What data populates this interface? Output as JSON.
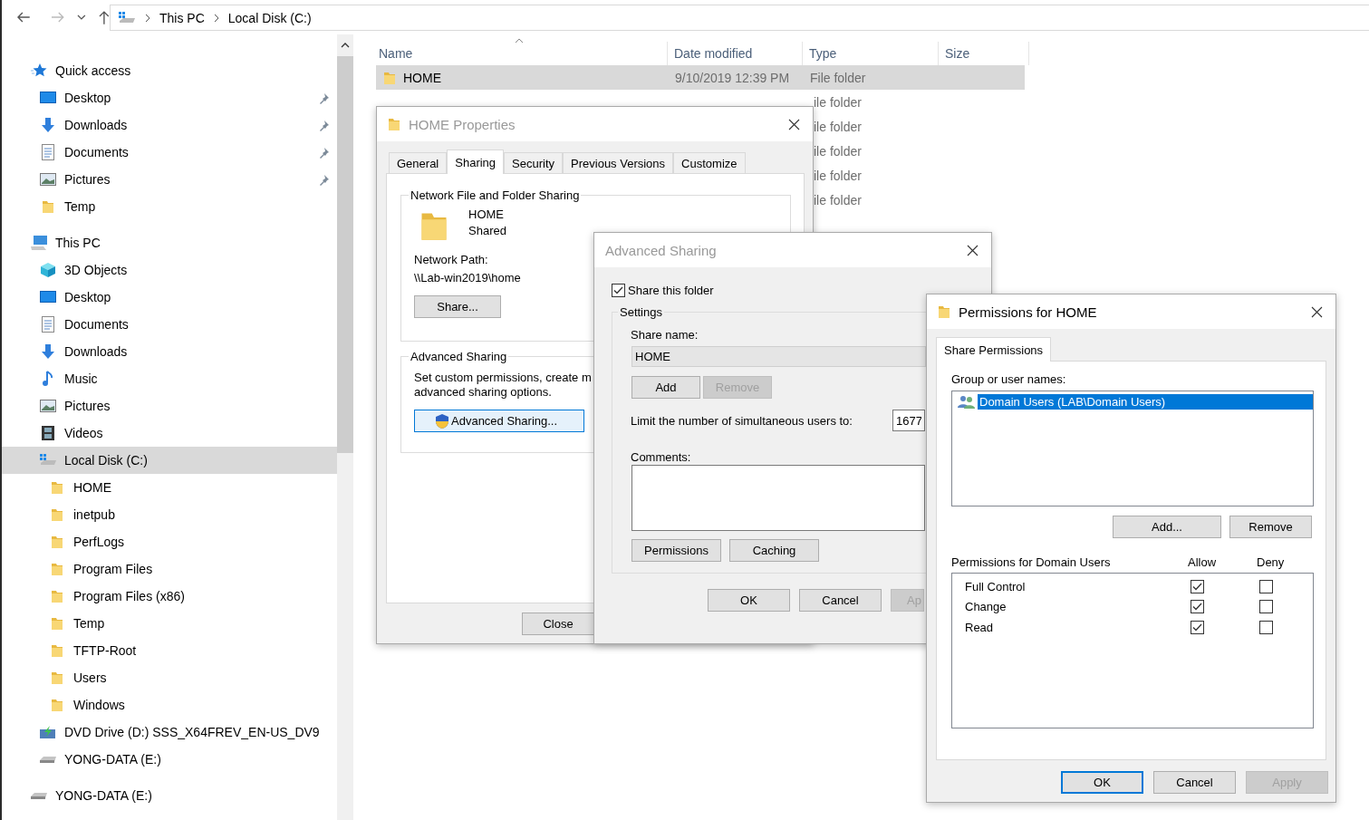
{
  "nav": {
    "path": [
      "This PC",
      "Local Disk (C:)"
    ]
  },
  "sidebar": {
    "items": [
      {
        "label": "Quick access",
        "kind": "star",
        "selected": false,
        "children": [
          {
            "label": "Desktop",
            "kind": "desktop",
            "pinned": true,
            "selected": false
          },
          {
            "label": "Downloads",
            "kind": "download",
            "pinned": true,
            "selected": false
          },
          {
            "label": "Documents",
            "kind": "document",
            "pinned": true,
            "selected": false
          },
          {
            "label": "Pictures",
            "kind": "picture",
            "pinned": true,
            "selected": false
          },
          {
            "label": "Temp",
            "kind": "folder",
            "pinned": false,
            "selected": false
          }
        ]
      },
      {
        "label": "This PC",
        "kind": "pc",
        "selected": false,
        "children": [
          {
            "label": "3D Objects",
            "kind": "cube",
            "selected": false
          },
          {
            "label": "Desktop",
            "kind": "desktop",
            "selected": false
          },
          {
            "label": "Documents",
            "kind": "document",
            "selected": false
          },
          {
            "label": "Downloads",
            "kind": "download",
            "selected": false
          },
          {
            "label": "Music",
            "kind": "music",
            "selected": false
          },
          {
            "label": "Pictures",
            "kind": "picture",
            "selected": false
          },
          {
            "label": "Videos",
            "kind": "video",
            "selected": false
          },
          {
            "label": "Local Disk (C:)",
            "kind": "system_drive",
            "selected": true,
            "children": [
              {
                "label": "HOME",
                "kind": "folder",
                "selected": false
              },
              {
                "label": "inetpub",
                "kind": "folder",
                "selected": false
              },
              {
                "label": "PerfLogs",
                "kind": "folder",
                "selected": false
              },
              {
                "label": "Program Files",
                "kind": "folder",
                "selected": false
              },
              {
                "label": "Program Files (x86)",
                "kind": "folder",
                "selected": false
              },
              {
                "label": "Temp",
                "kind": "folder",
                "selected": false
              },
              {
                "label": "TFTP-Root",
                "kind": "folder",
                "selected": false
              },
              {
                "label": "Users",
                "kind": "folder",
                "selected": false
              },
              {
                "label": "Windows",
                "kind": "folder",
                "selected": false
              }
            ]
          },
          {
            "label": "DVD Drive (D:) SSS_X64FREV_EN-US_DV9",
            "kind": "dvd",
            "selected": false
          },
          {
            "label": "YONG-DATA (E:)",
            "kind": "drive",
            "selected": false
          }
        ]
      },
      {
        "label": "YONG-DATA (E:)",
        "kind": "drive",
        "selected": false
      }
    ]
  },
  "file_list": {
    "columns": [
      "Name",
      "Date modified",
      "Type",
      "Size"
    ],
    "rows": [
      {
        "name": "HOME",
        "date": "9/10/2019 12:39 PM",
        "type": "File folder",
        "selected": true
      },
      {
        "type": "ile folder",
        "selected": false
      },
      {
        "type": "ile folder",
        "selected": false
      },
      {
        "type": "ile folder",
        "selected": false
      },
      {
        "type": "ile folder",
        "selected": false
      },
      {
        "type": "ile folder",
        "selected": false
      }
    ]
  },
  "properties_dialog": {
    "title": "HOME Properties",
    "active": false,
    "tabs": [
      {
        "label": "General",
        "selected": false
      },
      {
        "label": "Sharing",
        "selected": true
      },
      {
        "label": "Security",
        "selected": false
      },
      {
        "label": "Previous Versions",
        "selected": false
      },
      {
        "label": "Customize",
        "selected": false
      }
    ],
    "network_group": {
      "title": "Network File and Folder Sharing",
      "name": "HOME",
      "status": "Shared",
      "path_label": "Network Path:",
      "path": "\\\\Lab-win2019\\home",
      "button": "Share..."
    },
    "advanced_group": {
      "title": "Advanced Sharing",
      "description": [
        "Set custom permissions, create m",
        "advanced sharing options."
      ],
      "button": "Advanced Sharing..."
    },
    "buttons": [
      "Close"
    ]
  },
  "advanced_sharing_dialog": {
    "title": "Advanced Sharing",
    "active": false,
    "share_checkbox": {
      "label": "Share this folder",
      "checked": true
    },
    "settings": {
      "title": "Settings",
      "share_name_label": "Share name:",
      "share_name": "HOME",
      "name_buttons": [
        {
          "label": "Add",
          "disabled": false
        },
        {
          "label": "Remove",
          "disabled": true
        }
      ],
      "limit_label": "Limit the number of simultaneous users to:",
      "limit_value": "1677",
      "comments_label": "Comments:",
      "action_buttons": [
        "Permissions",
        "Caching"
      ]
    },
    "buttons": [
      {
        "label": "OK",
        "disabled": false
      },
      {
        "label": "Cancel",
        "disabled": false
      },
      {
        "label": "Ap",
        "disabled": true
      }
    ]
  },
  "permissions_dialog": {
    "title": "Permissions for HOME",
    "active": true,
    "tabs": [
      {
        "label": "Share Permissions",
        "selected": true
      }
    ],
    "group_label": "Group or user names:",
    "users": [
      {
        "name": "Domain Users (LAB\\Domain Users)",
        "selected": true
      }
    ],
    "user_buttons": [
      {
        "label": "Add...",
        "disabled": false
      },
      {
        "label": "Remove",
        "disabled": false
      }
    ],
    "permissions_label": "Permissions for Domain Users",
    "allow_header": "Allow",
    "deny_header": "Deny",
    "permissions": [
      {
        "name": "Full Control",
        "allow": true,
        "deny": false
      },
      {
        "name": "Change",
        "allow": true,
        "deny": false
      },
      {
        "name": "Read",
        "allow": true,
        "deny": false
      }
    ],
    "buttons": [
      {
        "label": "OK",
        "default": true,
        "disabled": false
      },
      {
        "label": "Cancel",
        "default": false,
        "disabled": false
      },
      {
        "label": "Apply",
        "default": false,
        "disabled": true
      }
    ]
  }
}
